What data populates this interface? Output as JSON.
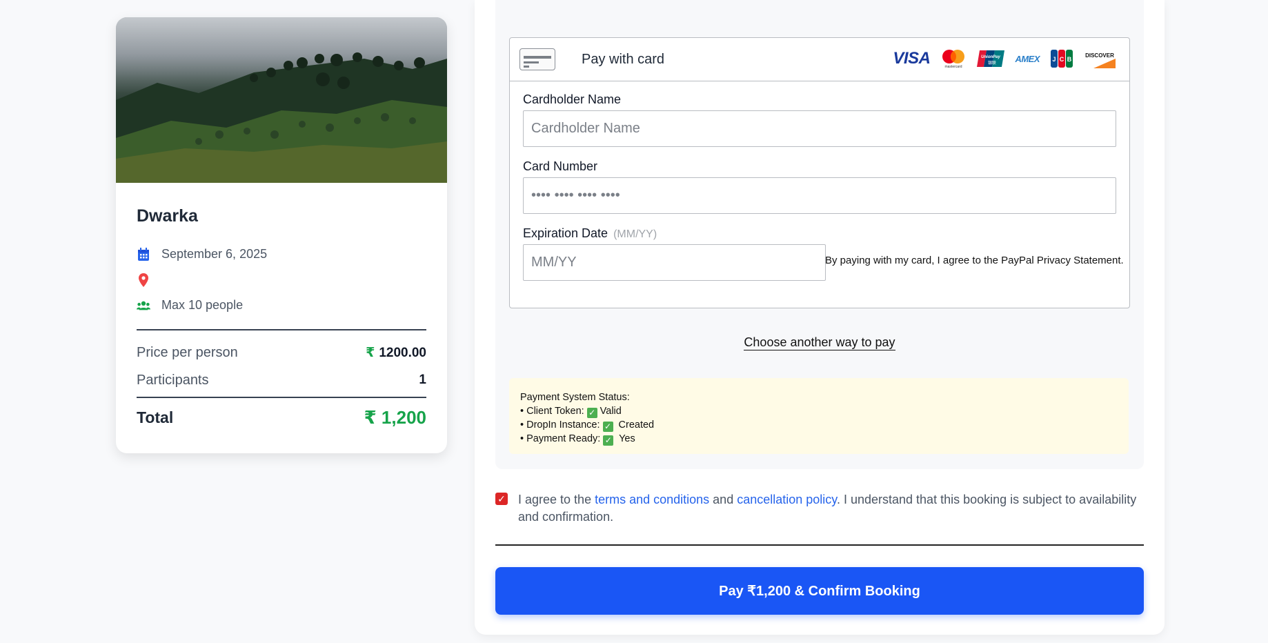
{
  "summary": {
    "title": "Dwarka",
    "date": "September 6, 2025",
    "location": "",
    "capacity": "Max 10 people",
    "price_label": "Price per person",
    "price_currency": "₹",
    "price_value": "1200.00",
    "participants_label": "Participants",
    "participants_value": "1",
    "total_label": "Total",
    "total_value": "₹ 1,200"
  },
  "payment": {
    "pay_with_card": "Pay with card",
    "brands": [
      "VISA",
      "mastercard",
      "UnionPay",
      "AMEX",
      "JCB",
      "DISCOVER"
    ],
    "cardholder_label": "Cardholder Name",
    "cardholder_placeholder": "Cardholder Name",
    "card_number_label": "Card Number",
    "card_number_placeholder": "•••• •••• •••• ••••",
    "expiration_label": "Expiration Date",
    "expiration_hint": "(MM/YY)",
    "expiration_placeholder": "MM/YY",
    "agreement_note": "By paying with my card, I agree to the PayPal Privacy Statement.",
    "another_way": "Choose another way to pay"
  },
  "status": {
    "heading": "Payment System Status:",
    "client_token_label": "• Client Token:",
    "client_token_value": "Valid",
    "dropin_label": "• DropIn Instance:",
    "dropin_value": "Created",
    "ready_label": "• Payment Ready:",
    "ready_value": "Yes"
  },
  "terms": {
    "prefix": "I agree to the ",
    "terms_link": "terms and conditions",
    "middle": " and ",
    "cancel_link": "cancellation policy",
    "suffix": ". I understand that this booking is subject to availability and confirmation.",
    "checked": true
  },
  "pay_button": "Pay ₹1,200 & Confirm Booking",
  "colors": {
    "accent_blue": "#1a56f5",
    "price_green": "#16a34a",
    "checkbox_red": "#dc2626",
    "status_bg": "#fffbe6"
  }
}
